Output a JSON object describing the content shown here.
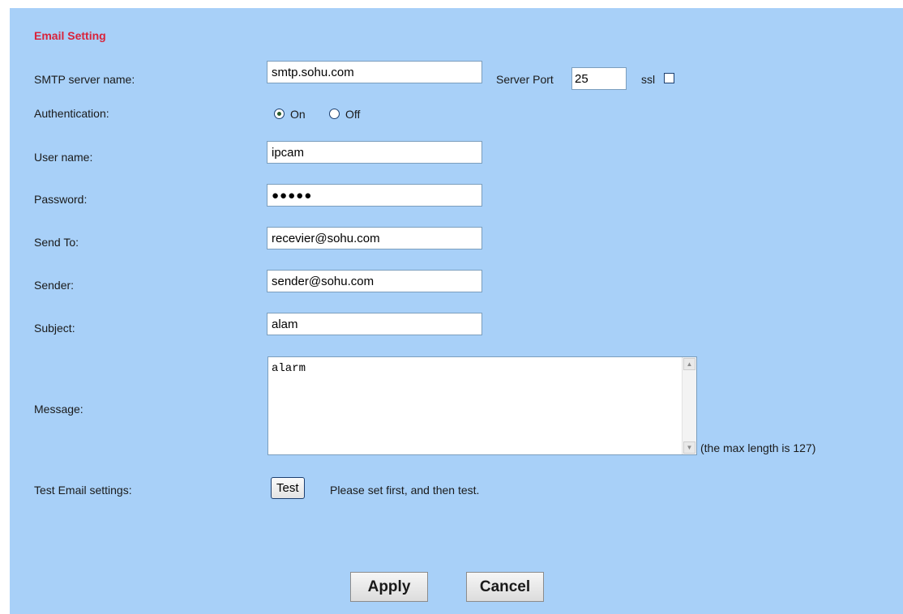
{
  "section_title": "Email Setting",
  "smtp": {
    "label": "SMTP server name:",
    "value": "smtp.sohu.com",
    "port_label": "Server Port",
    "port_value": "25",
    "ssl_label": "ssl",
    "ssl_checked": false
  },
  "authentication": {
    "label": "Authentication:",
    "on_label": "On",
    "off_label": "Off",
    "selected": "On"
  },
  "username": {
    "label": "User name:",
    "value": "ipcam"
  },
  "password": {
    "label": "Password:",
    "masked": "●●●●●"
  },
  "send_to": {
    "label": "Send To:",
    "value": "recevier@sohu.com"
  },
  "sender": {
    "label": "Sender:",
    "value": "sender@sohu.com"
  },
  "subject": {
    "label": "Subject:",
    "value": "alam"
  },
  "message": {
    "label": "Message:",
    "value": "alarm",
    "max_length_note": "(the max length is 127)"
  },
  "test": {
    "label": "Test Email settings:",
    "button": "Test",
    "hint": "Please set first, and then test."
  },
  "actions": {
    "apply": "Apply",
    "cancel": "Cancel"
  },
  "colors": {
    "panel_bg": "#a8d0f8",
    "title_red": "#d9233b"
  }
}
